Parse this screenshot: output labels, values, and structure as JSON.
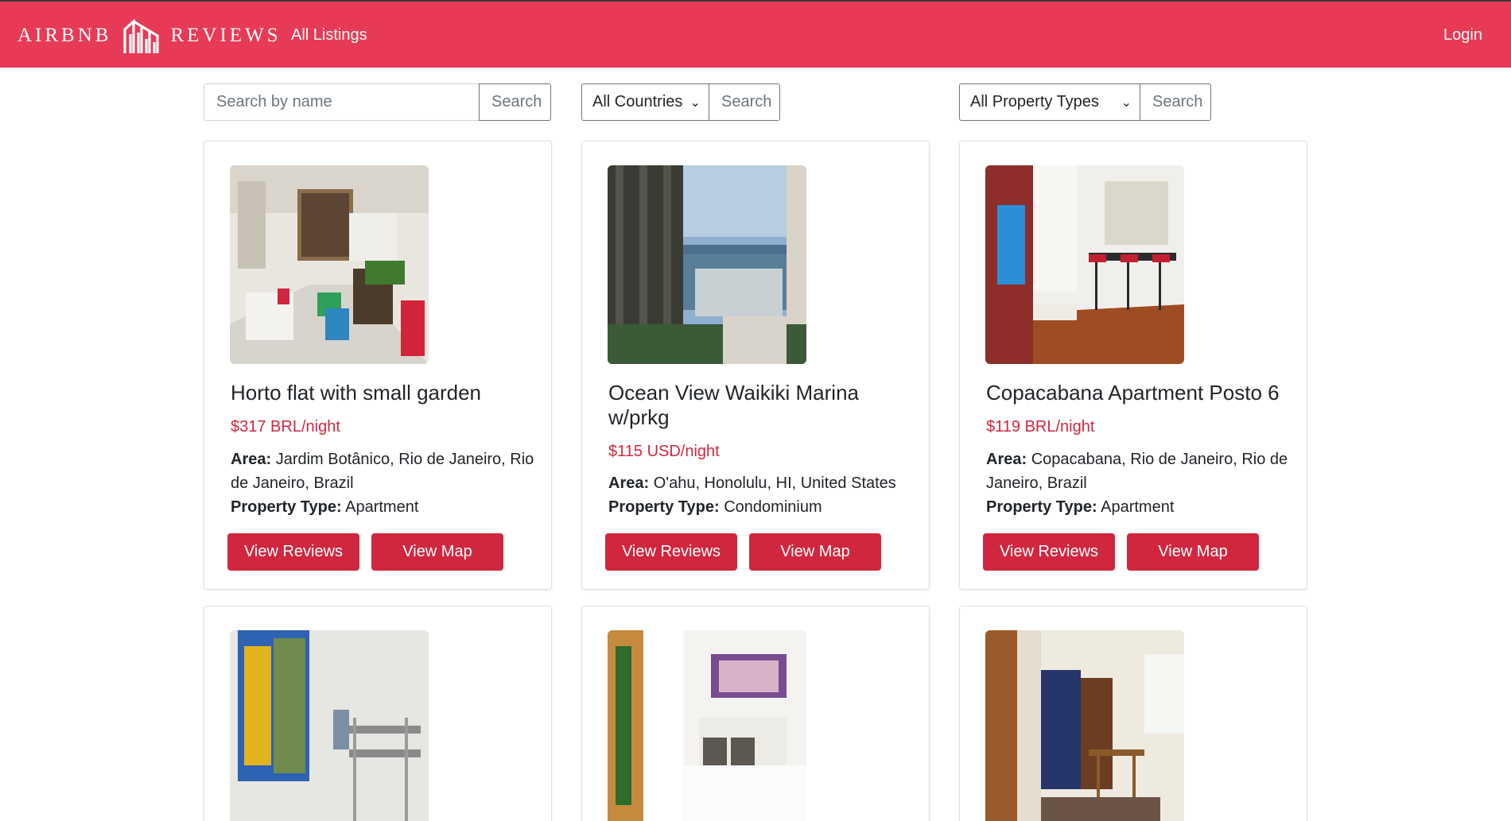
{
  "nav": {
    "brand_left": "AIRBNB",
    "brand_right": "REVIEWS",
    "all_listings": "All Listings",
    "login": "Login"
  },
  "search": {
    "name_placeholder": "Search by name",
    "name_button": "Search",
    "country_selected": "All Countries",
    "country_button": "Search",
    "type_selected": "All Property Types",
    "type_button": "Search"
  },
  "labels": {
    "area": "Area:",
    "property_type": "Property Type:",
    "view_reviews": "View Reviews",
    "view_map": "View Map"
  },
  "listings": [
    {
      "title": "Horto flat with small garden",
      "price": "$317 BRL/night",
      "area": "Jardim Botânico, Rio de Janeiro, Rio de Janeiro, Brazil",
      "property_type": "Apartment"
    },
    {
      "title": "Ocean View Waikiki Marina w/prkg",
      "price": "$115 USD/night",
      "area": "O'ahu, Honolulu, HI, United States",
      "property_type": "Condominium"
    },
    {
      "title": "Copacabana Apartment Posto 6",
      "price": "$119 BRL/night",
      "area": "Copacabana, Rio de Janeiro, Rio de Janeiro, Brazil",
      "property_type": "Apartment"
    }
  ],
  "colors": {
    "navbar": "#e73a56",
    "accent": "#d0273f"
  }
}
